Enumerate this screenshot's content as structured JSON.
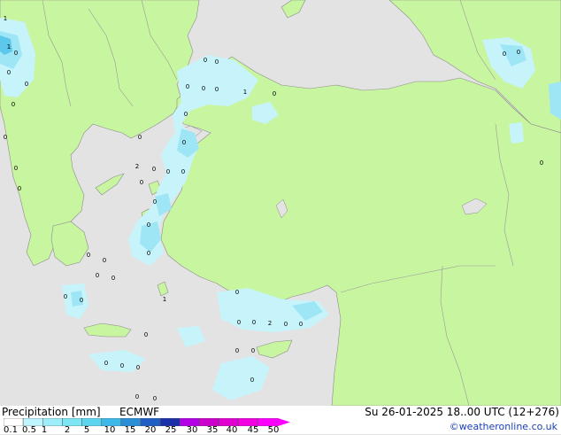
{
  "title": "Precipitation [mm]",
  "model": "ECMWF",
  "valid_time": "Su 26-01-2025 18..00 UTC (12+276)",
  "credit": "©weatheronline.co.uk",
  "legend": {
    "ticks": [
      "0.1",
      "0.5",
      "1",
      "2",
      "5",
      "10",
      "15",
      "20",
      "25",
      "30",
      "35",
      "40",
      "45",
      "50"
    ],
    "colors": [
      "#ffffff",
      "#bff5ff",
      "#9eeefa",
      "#7de6f5",
      "#5cd6f0",
      "#3eb8e8",
      "#2a8fd6",
      "#1f5fc4",
      "#1a2fa8",
      "#b400e6",
      "#cc00cc",
      "#e000d0",
      "#f000e0",
      "#ff00ff"
    ]
  },
  "colors": {
    "land": "#c8f59f",
    "sea": "#e3e3e3",
    "border": "#8c8c8c",
    "precip_light": "#c7f4fb",
    "precip_mid": "#9ee6f5",
    "precip_heavy": "#5cc8ec"
  },
  "map_labels": [
    "1",
    "0",
    "0",
    "1",
    "0",
    "0",
    "0",
    "0",
    "1",
    "0",
    "0",
    "0",
    "0",
    "0",
    "2",
    "0",
    "0",
    "0",
    "0",
    "0",
    "0",
    "0",
    "0",
    "0",
    "0",
    "0",
    "0",
    "0",
    "0",
    "0",
    "0",
    "2",
    "0",
    "0",
    "0",
    "0",
    "0",
    "0",
    "0",
    "0",
    "0",
    "0",
    "0",
    "0",
    "0",
    "0",
    "0",
    "0",
    "0",
    "1",
    "0",
    "0"
  ]
}
